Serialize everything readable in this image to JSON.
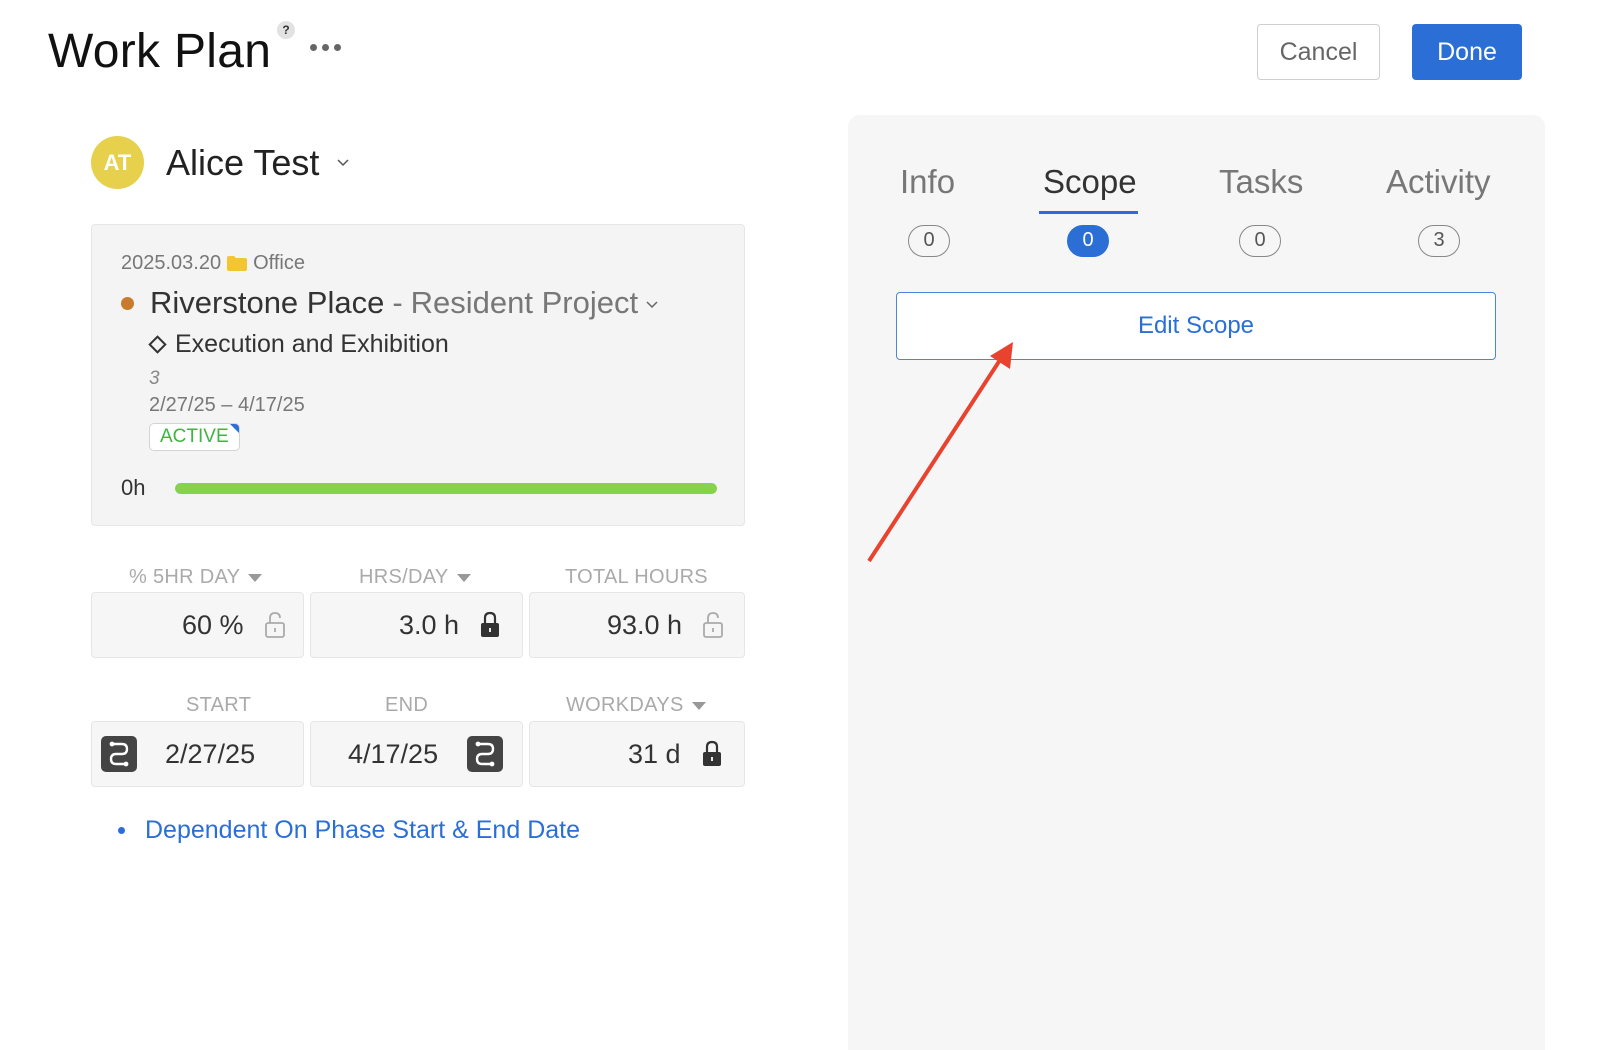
{
  "header": {
    "title": "Work Plan",
    "help": "?",
    "cancel_label": "Cancel",
    "done_label": "Done"
  },
  "user": {
    "initials": "AT",
    "name": "Alice Test"
  },
  "project": {
    "date_code": "2025.03.20",
    "location": "Office",
    "name": "Riverstone Place",
    "separator": "-",
    "subtitle": "Resident Project",
    "phase": "Execution and Exhibition",
    "phase_number": "3",
    "dates": "2/27/25 – 4/17/25",
    "status": "ACTIVE",
    "hours": "0h",
    "progress_fraction": 1.0
  },
  "fields": {
    "pct_label": "% 5HR DAY",
    "pct_value": "60 %",
    "hrs_label": "HRS/DAY",
    "hrs_value": "3.0 h",
    "total_label": "TOTAL HOURS",
    "total_value": "93.0 h",
    "start_label": "START",
    "start_value": "2/27/25",
    "end_label": "END",
    "end_value": "4/17/25",
    "workdays_label": "WORKDAYS",
    "workdays_value": "31 d"
  },
  "dependency_link": "Dependent On Phase Start & End Date",
  "panel": {
    "tabs": [
      {
        "label": "Info",
        "count": "0"
      },
      {
        "label": "Scope",
        "count": "0"
      },
      {
        "label": "Tasks",
        "count": "0"
      },
      {
        "label": "Activity",
        "count": "3"
      }
    ],
    "edit_scope_label": "Edit Scope"
  },
  "colors": {
    "accent": "#2b6fd6",
    "avatar": "#e7d04b",
    "project_dot": "#c97a2c",
    "status_green": "#3fb53f",
    "progress_green": "#86d24a",
    "arrow": "#e8432f"
  }
}
